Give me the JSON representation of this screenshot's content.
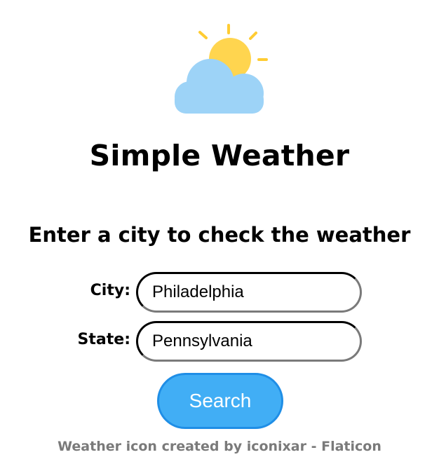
{
  "header": {
    "logo_icon": "sun-behind-cloud-icon",
    "title": "Simple Weather"
  },
  "form": {
    "prompt": "Enter a city to check the weather",
    "city_label": "City:",
    "city_value": "Philadelphia",
    "state_label": "State:",
    "state_value": "Pennsylvania",
    "search_label": "Search"
  },
  "footer": {
    "credit": "Weather icon created by iconixar - Flaticon"
  },
  "colors": {
    "sun": "#FFD54F",
    "sun_rays": "#FFCC33",
    "cloud": "#9DD3F7",
    "button": "#41AEF5",
    "credit_text": "#7A7A7A"
  }
}
